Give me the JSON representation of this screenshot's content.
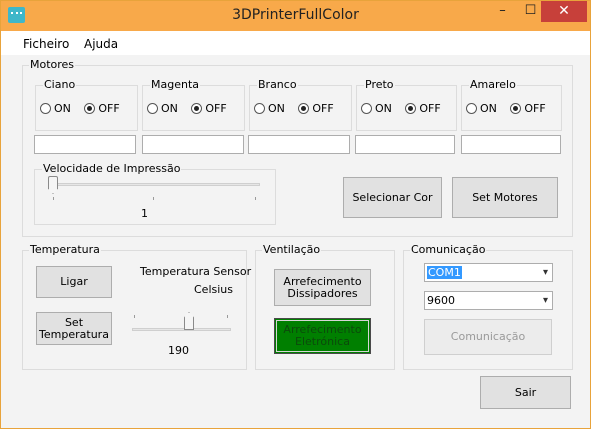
{
  "window": {
    "title": "3DPrinterFullColor",
    "minimize": "–",
    "maximize": "☐",
    "close": "✕"
  },
  "menu": {
    "file": "Ficheiro",
    "help": "Ajuda"
  },
  "motores": {
    "legend": "Motores",
    "groups": [
      {
        "label": "Ciano",
        "on": "ON",
        "off": "OFF",
        "selected": "OFF"
      },
      {
        "label": "Magenta",
        "on": "ON",
        "off": "OFF",
        "selected": "OFF"
      },
      {
        "label": "Branco",
        "on": "ON",
        "off": "OFF",
        "selected": "OFF"
      },
      {
        "label": "Preto",
        "on": "ON",
        "off": "OFF",
        "selected": "OFF"
      },
      {
        "label": "Amarelo",
        "on": "ON",
        "off": "OFF",
        "selected": "OFF"
      }
    ],
    "velocidade": {
      "legend": "Velocidade de Impressão",
      "value": "1"
    },
    "select_color": "Selecionar Cor",
    "set_motors": "Set Motores"
  },
  "temperatura": {
    "legend": "Temperatura",
    "ligar": "Ligar",
    "set_temp_line1": "Set",
    "set_temp_line2": "Temperatura",
    "sensor_line1": "Temperatura Sensor",
    "sensor_line2": "Celsius",
    "slider_value": "190"
  },
  "ventilacao": {
    "legend": "Ventilação",
    "dissipadores_line1": "Arrefecimento",
    "dissipadores_line2": "Dissipadores",
    "eletronica_line1": "Arrefecimento",
    "eletronica_line2": "Eletrónica"
  },
  "comunicacao": {
    "legend": "Comunicação",
    "port": "COM1",
    "baud": "9600",
    "button": "Comunicação"
  },
  "sair": "Sair",
  "colors": {
    "titlebar": "#f8a94a",
    "close": "#c7403a",
    "active_green": "#007f00",
    "selection": "#3399ff"
  }
}
